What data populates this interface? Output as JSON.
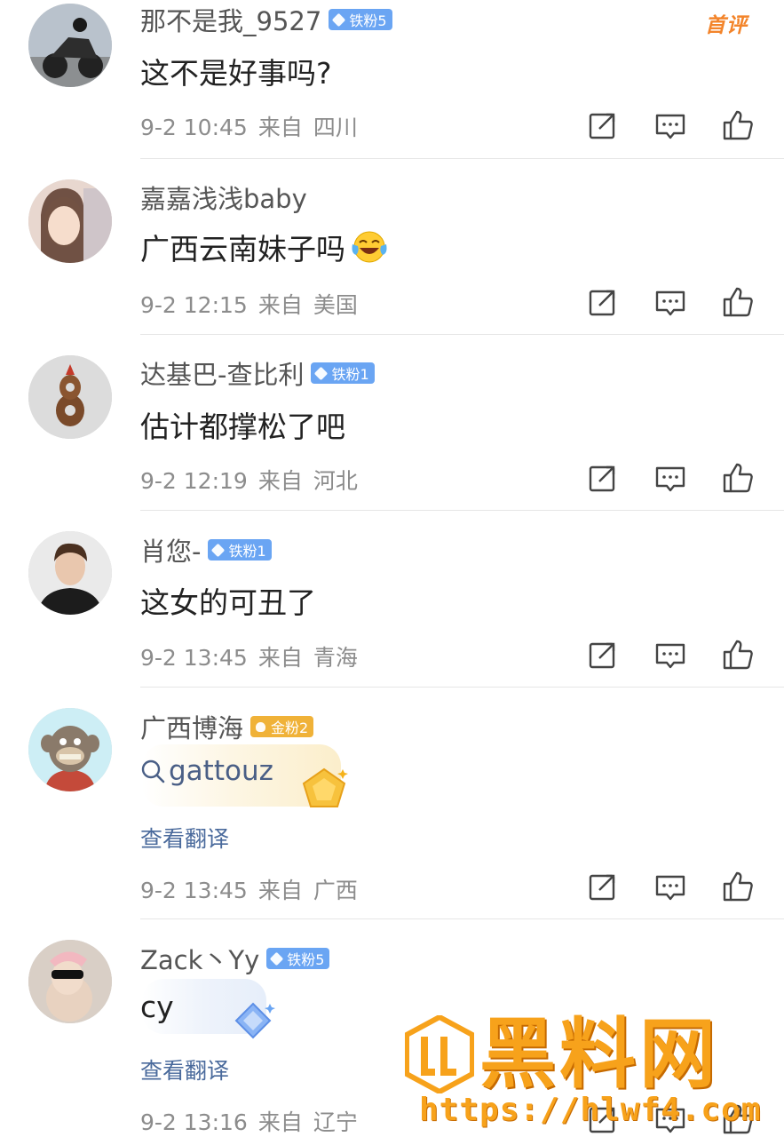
{
  "comments": [
    {
      "username": "那不是我_9527",
      "badge": "铁粉5",
      "tag": "首评",
      "text": "这不是好事吗?",
      "date": "9-2 10:45",
      "from": "来自",
      "location": "四川"
    },
    {
      "username": "嘉嘉浅浅baby",
      "text": "广西云南妹子吗",
      "emoji": "laughing-tears-emoji",
      "date": "9-2 12:15",
      "from": "来自",
      "location": "美国"
    },
    {
      "username": "达基巴-查比利",
      "badge": "铁粉1",
      "text": "估计都撑松了吧",
      "date": "9-2 12:19",
      "from": "来自",
      "location": "河北"
    },
    {
      "username": "肖您-",
      "badge": "铁粉1",
      "text": "这女的可丑了",
      "date": "9-2 13:45",
      "from": "来自",
      "location": "青海"
    },
    {
      "username": "广西博海",
      "badge": "金粉2",
      "text": "gattouz",
      "translate": "查看翻译",
      "date": "9-2 13:45",
      "from": "来自",
      "location": "广西"
    },
    {
      "username": "Zack丶Yy",
      "badge": "铁粉5",
      "text": "cy",
      "translate": "查看翻译",
      "date": "9-2 13:16",
      "from": "来自",
      "location": "辽宁"
    }
  ],
  "icons": [
    "share-icon",
    "comment-icon",
    "like-icon"
  ],
  "watermark": {
    "title": "黑料网",
    "url": "https://hlwf4.com"
  },
  "colors": {
    "iron_badge": "#6aa5f3",
    "gold_badge": "#f0b238",
    "first_tag": "#f3842a",
    "watermark": "#f7a21b"
  }
}
